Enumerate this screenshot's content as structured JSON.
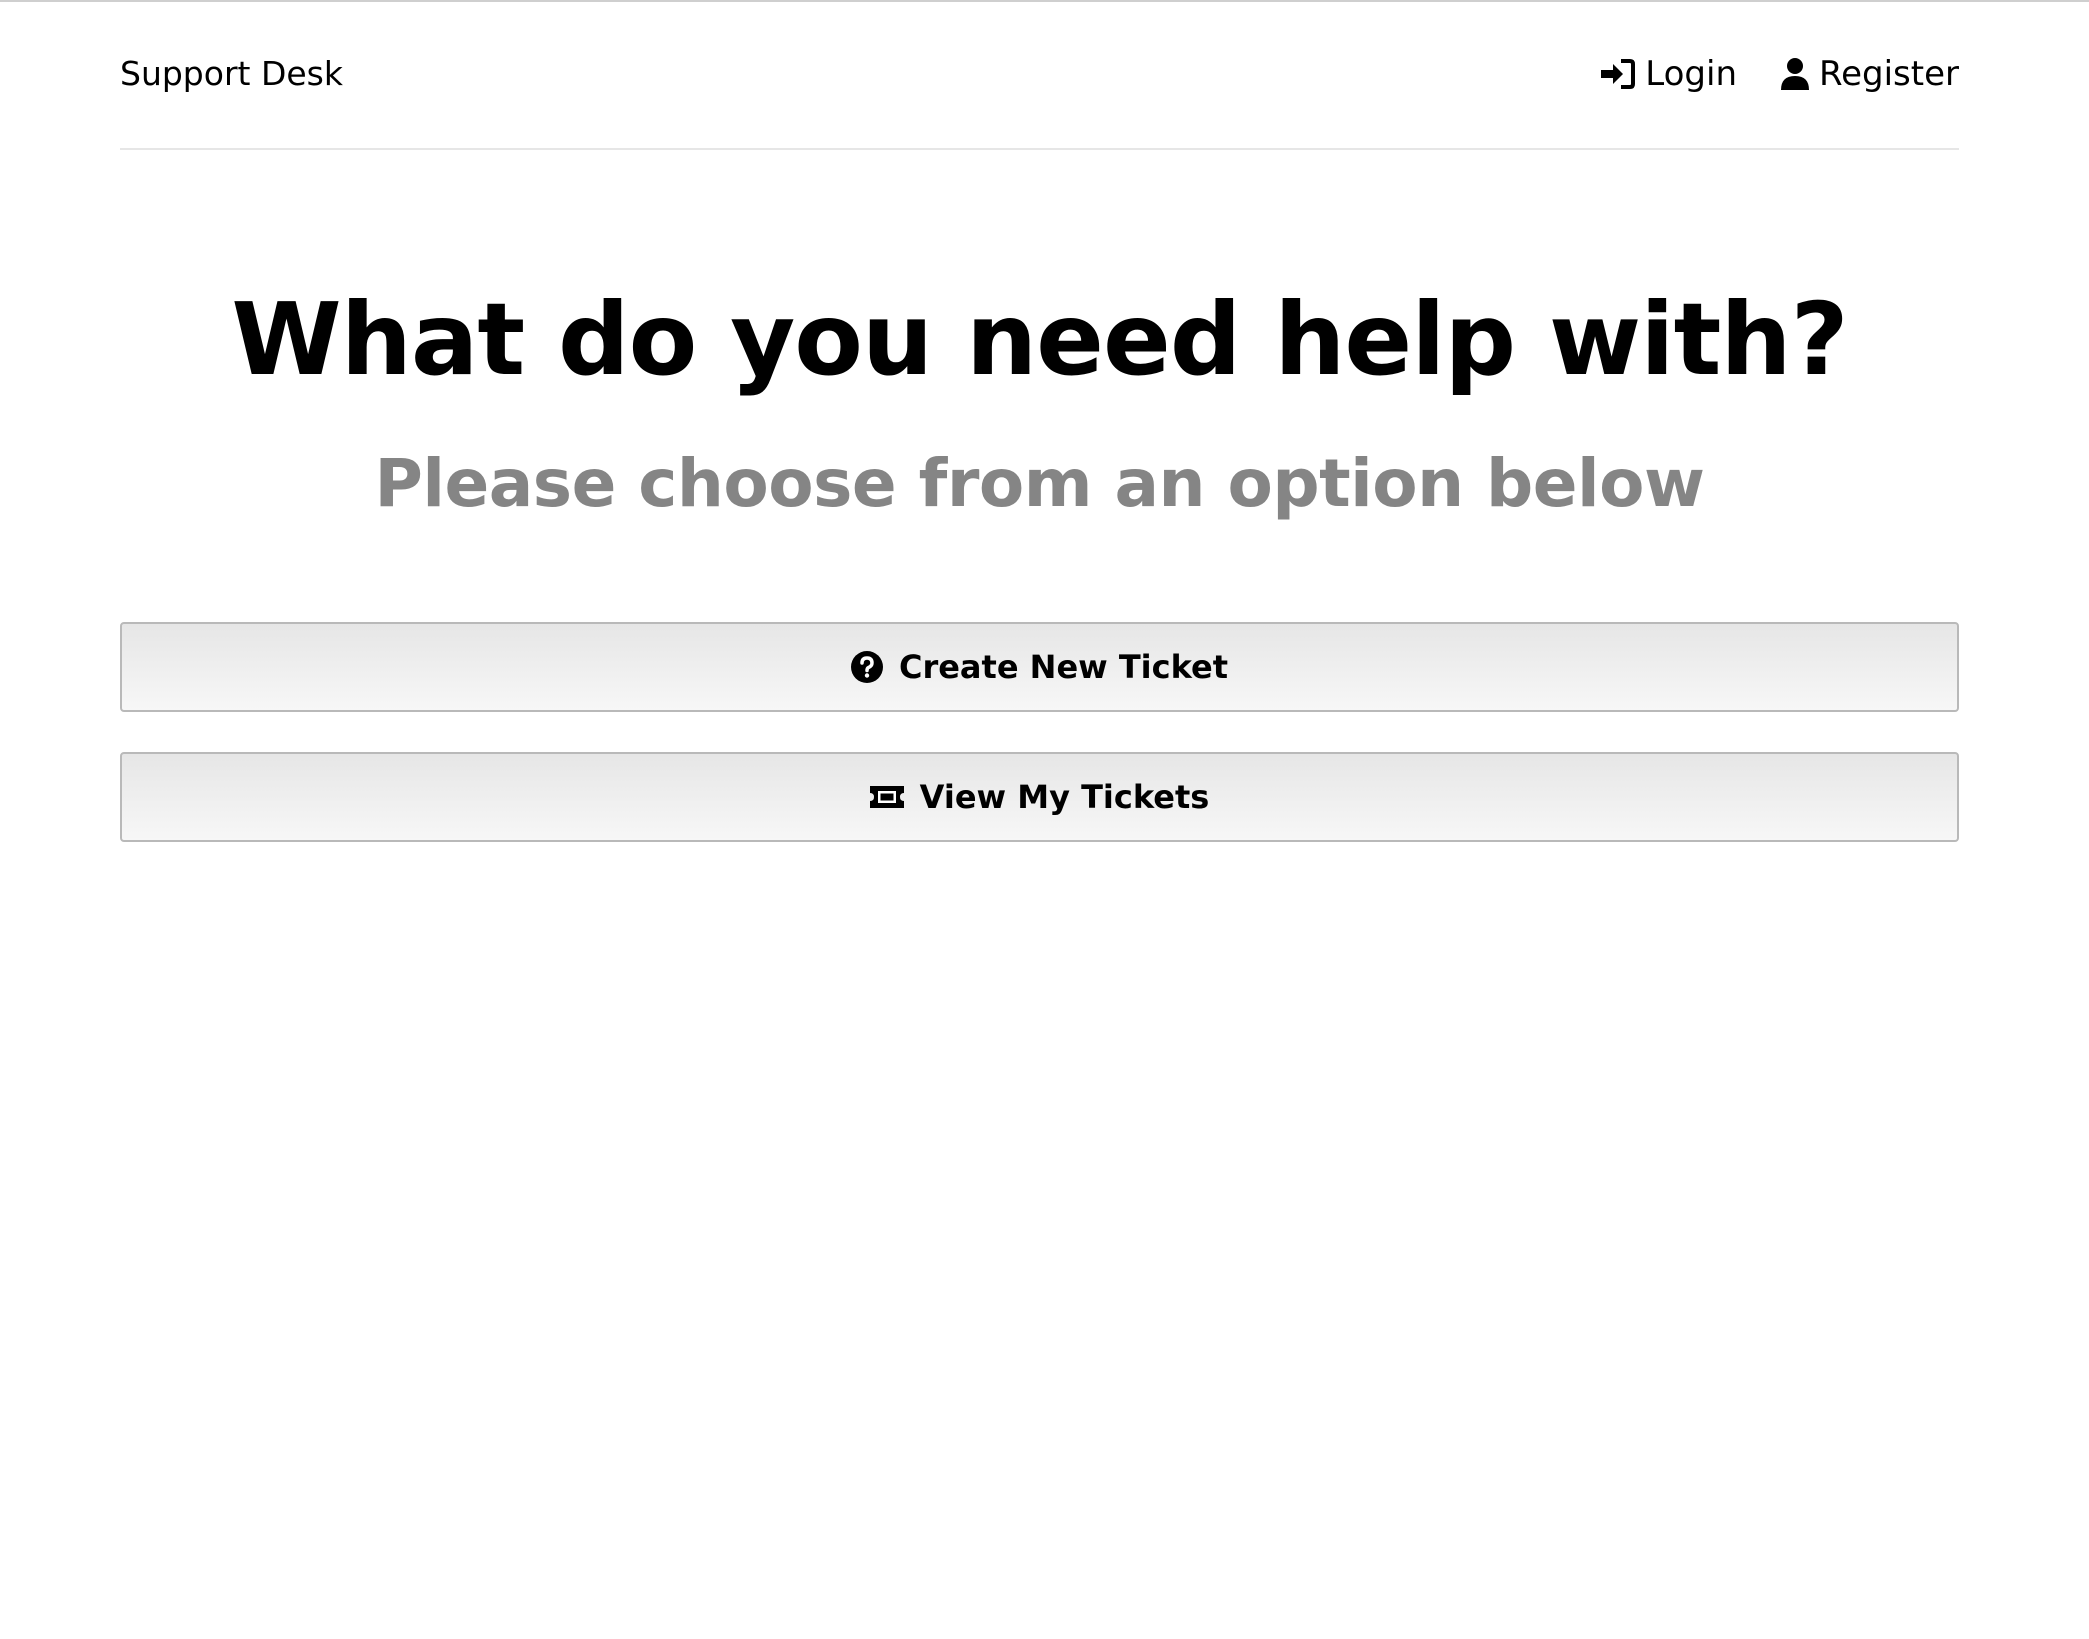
{
  "header": {
    "logo": "Support Desk",
    "nav": [
      {
        "label": "Login",
        "icon": "sign-in-icon"
      },
      {
        "label": "Register",
        "icon": "user-icon"
      }
    ]
  },
  "hero": {
    "title": "What do you need help with?",
    "subtitle": "Please choose from an option below"
  },
  "actions": [
    {
      "label": "Create New Ticket",
      "icon": "question-circle-icon"
    },
    {
      "label": "View My Tickets",
      "icon": "ticket-icon"
    }
  ],
  "colors": {
    "text": "#000000",
    "subtitle": "#858585",
    "border": "#b9b9b9",
    "divider": "#e6e6e6"
  }
}
